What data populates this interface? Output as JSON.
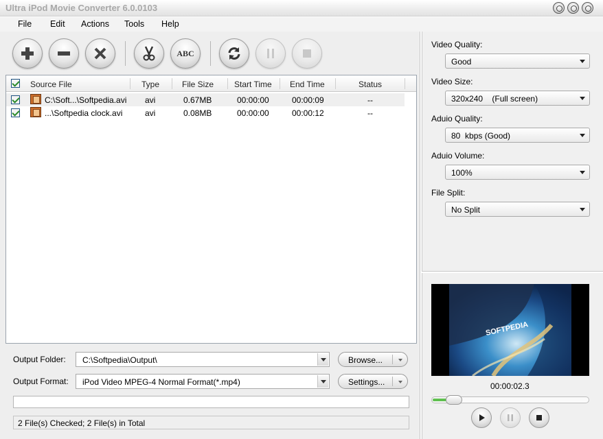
{
  "window": {
    "title": "Ultra iPod Movie Converter 6.0.0103"
  },
  "menu": [
    "File",
    "Edit",
    "Actions",
    "Tools",
    "Help"
  ],
  "toolbar": {
    "icons": [
      "add-icon",
      "remove-icon",
      "clear-icon",
      "cut-icon",
      "rename-icon",
      "convert-icon",
      "pause-icon",
      "stop-icon"
    ],
    "rename_text": "ABC"
  },
  "file_list": {
    "columns": [
      "Source File",
      "Type",
      "File Size",
      "Start Time",
      "End Time",
      "Status"
    ],
    "rows": [
      {
        "source": "C:\\Soft...\\Softpedia.avi",
        "type": "avi",
        "size": "0.67MB",
        "start": "00:00:00",
        "end": "00:00:09",
        "status": "--",
        "checked": true
      },
      {
        "source": "...\\Softpedia clock.avi",
        "type": "avi",
        "size": "0.08MB",
        "start": "00:00:00",
        "end": "00:00:12",
        "status": "--",
        "checked": true
      }
    ]
  },
  "output": {
    "folder_label": "Output Folder:",
    "folder_value": "C:\\Softpedia\\Output\\",
    "browse_label": "Browse...",
    "format_label": "Output Format:",
    "format_value": "iPod Video MPEG-4 Normal Format(*.mp4)",
    "settings_label": "Settings..."
  },
  "progress": {
    "fraction": 0
  },
  "status_text": "2 File(s) Checked; 2 File(s) in Total",
  "settings": {
    "video_quality_label": "Video Quality:",
    "video_quality": "Good",
    "video_size_label": "Video Size:",
    "video_size": "320x240    (Full screen)",
    "audio_quality_label": "Aduio Quality:",
    "audio_quality": "80  kbps (Good)",
    "audio_volume_label": "Aduio Volume:",
    "audio_volume": "100%",
    "file_split_label": "File Split:",
    "file_split": "No Split"
  },
  "preview": {
    "time": "00:00:02.3",
    "position_fraction": 0.1,
    "watermark": "SOFTPEDIA"
  },
  "colors": {
    "accent_green": "#5fbf4f",
    "title_gray": "#a8a8a8"
  }
}
